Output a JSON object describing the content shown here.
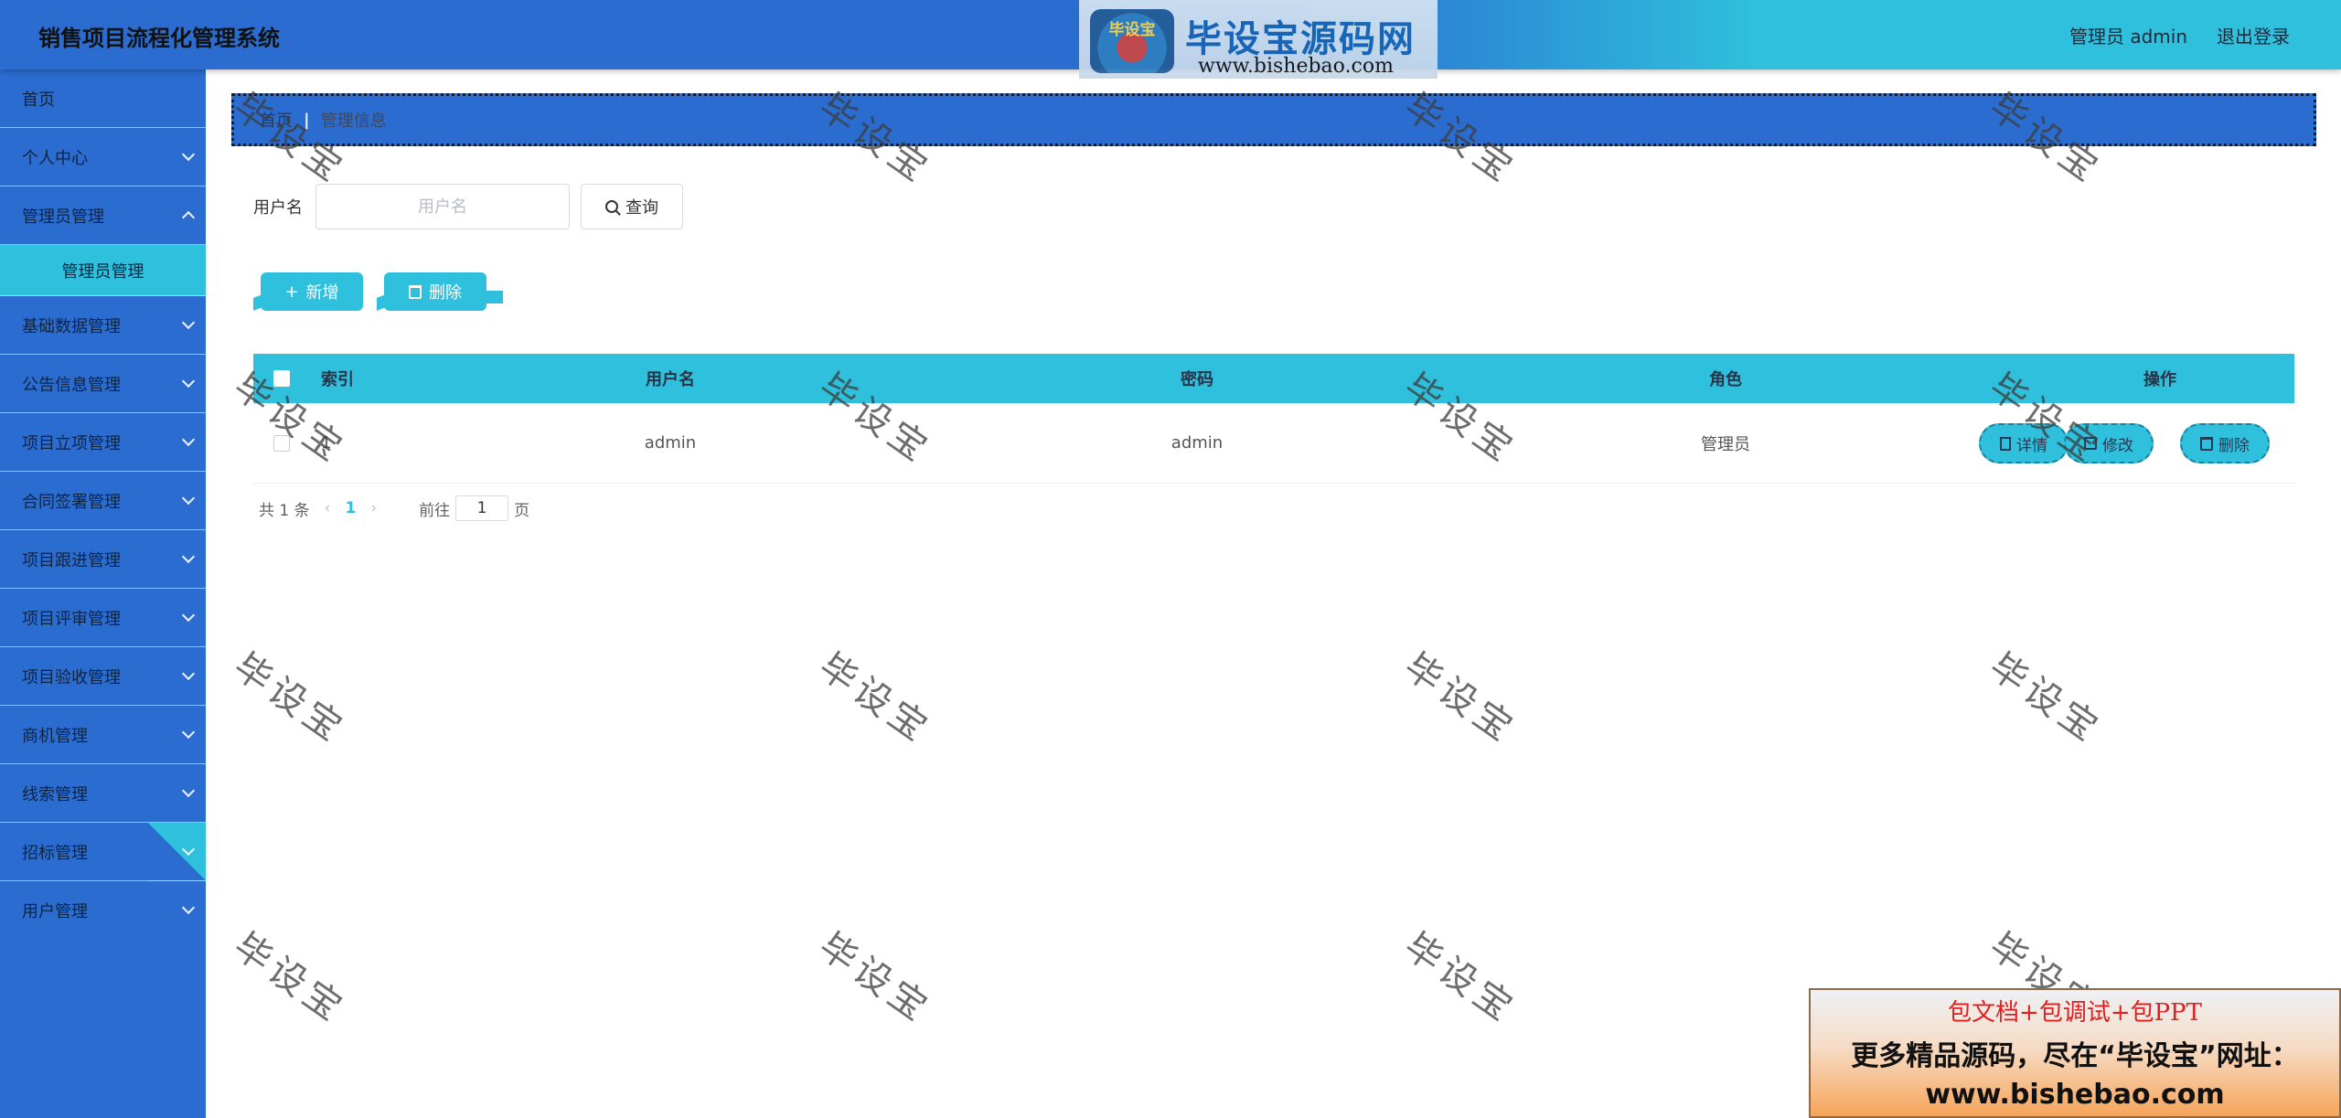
{
  "header": {
    "title": "销售项目流程化管理系统",
    "user_label": "管理员 admin",
    "logout_label": "退出登录"
  },
  "brand": {
    "seal_text": "毕设宝",
    "name": "毕设宝源码网",
    "url": "www.bishebao.com"
  },
  "sidebar": {
    "items": [
      {
        "label": "首页"
      },
      {
        "label": "个人中心"
      },
      {
        "label": "管理员管理"
      },
      {
        "label": "管理员管理"
      },
      {
        "label": "基础数据管理"
      },
      {
        "label": "公告信息管理"
      },
      {
        "label": "项目立项管理"
      },
      {
        "label": "合同签署管理"
      },
      {
        "label": "项目跟进管理"
      },
      {
        "label": "项目评审管理"
      },
      {
        "label": "项目验收管理"
      },
      {
        "label": "商机管理"
      },
      {
        "label": "线索管理"
      },
      {
        "label": "招标管理"
      },
      {
        "label": "用户管理"
      }
    ]
  },
  "breadcrumb": {
    "home": "首页",
    "current": "管理信息"
  },
  "search": {
    "label": "用户名",
    "placeholder": "用户名",
    "button_label": "查询"
  },
  "actions": {
    "add_label": "新增",
    "delete_label": "删除"
  },
  "table": {
    "columns": [
      "索引",
      "用户名",
      "密码",
      "角色",
      "操作"
    ],
    "rows": [
      {
        "index": "1",
        "username": "admin",
        "password": "admin",
        "role": "管理员",
        "detail_label": "详情",
        "edit_label": "修改",
        "delete_label": "删除"
      }
    ]
  },
  "pagination": {
    "total_text": "共 1 条",
    "current_page": "1",
    "goto_label": "前往",
    "goto_value": "1",
    "page_suffix": "页"
  },
  "watermark": "毕设宝",
  "promo": {
    "line1": "包文档+包调试+包PPT",
    "line2": "更多精品源码，尽在“毕设宝”网址：",
    "line3": "www.bishebao.com"
  },
  "colors": {
    "primary_blue": "#2b6cd0",
    "accent_cyan": "#2ec0dc"
  }
}
